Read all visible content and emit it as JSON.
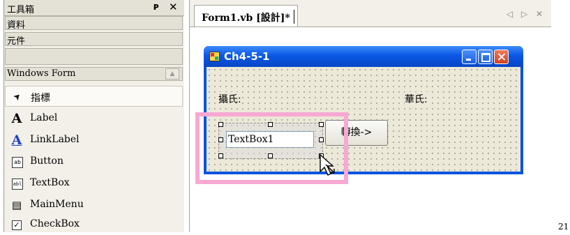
{
  "toolbox": {
    "title": "工具箱",
    "pin_glyph": "ᴘ",
    "close_glyph": "✕",
    "tabs": [
      {
        "label": "資料"
      },
      {
        "label": "元件"
      },
      {
        "label": "Windows Form"
      }
    ],
    "tools": [
      {
        "label": "指標",
        "icon": "pointer-icon",
        "glyph": "➤"
      },
      {
        "label": "Label",
        "icon": "label-icon",
        "glyph": "A"
      },
      {
        "label": "LinkLabel",
        "icon": "linklabel-icon",
        "glyph": "A"
      },
      {
        "label": "Button",
        "icon": "button-icon",
        "glyph": "ab"
      },
      {
        "label": "TextBox",
        "icon": "textbox-icon",
        "glyph": "abl"
      },
      {
        "label": "MainMenu",
        "icon": "mainmenu-icon",
        "glyph": "▤"
      },
      {
        "label": "CheckBox",
        "icon": "checkbox-icon",
        "glyph": "✓"
      }
    ]
  },
  "designer": {
    "tab_label": "Form1.vb [設計]*",
    "nav_glyphs": "◁ ▷ ✕"
  },
  "form": {
    "title": "Ch4-5-1",
    "label_celsius": "攝氏:",
    "label_fahrenheit": "華氏:",
    "textbox_value": "TextBox1",
    "button_label": "轉換->"
  },
  "page_number": "21",
  "colors": {
    "titlebar_blue": "#0a58e6",
    "highlight_pink": "#f7a8d3",
    "form_bg": "#ece9d8"
  }
}
